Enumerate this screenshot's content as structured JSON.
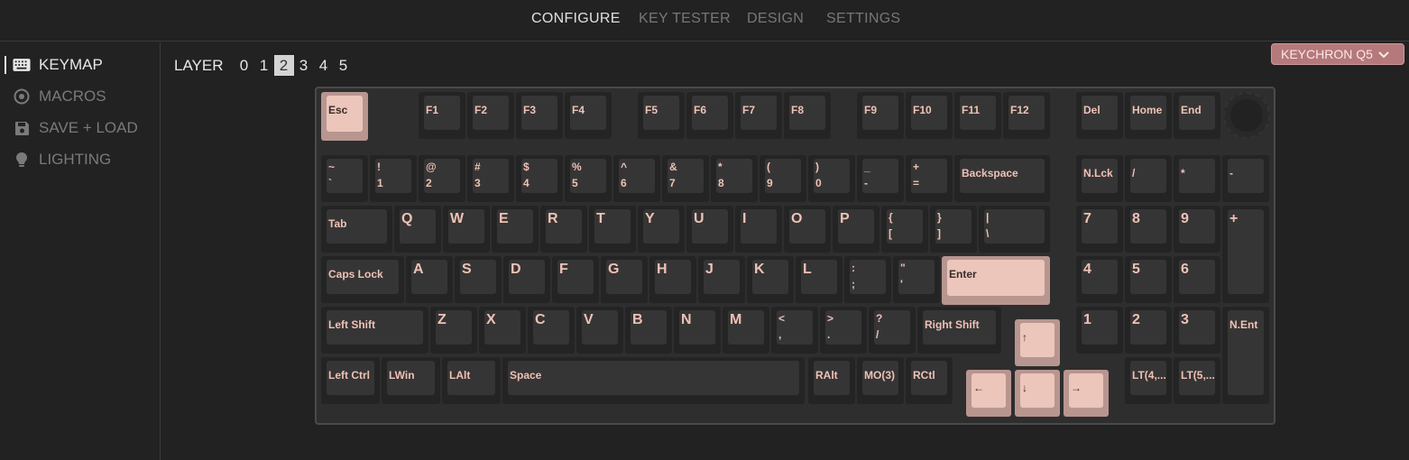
{
  "topnav": {
    "tabs": [
      {
        "label": "CONFIGURE"
      },
      {
        "label": "KEY TESTER"
      },
      {
        "label": "DESIGN"
      },
      {
        "label": "SETTINGS"
      }
    ]
  },
  "sidebar": {
    "items": [
      {
        "label": "KEYMAP",
        "icon": "keyboard-icon"
      },
      {
        "label": "MACROS",
        "icon": "macro-icon"
      },
      {
        "label": "SAVE + LOAD",
        "icon": "save-icon"
      },
      {
        "label": "LIGHTING",
        "icon": "lightbulb-icon"
      }
    ]
  },
  "layer": {
    "label": "LAYER",
    "options": [
      "0",
      "1",
      "2",
      "3",
      "4",
      "5"
    ],
    "selected": "2"
  },
  "keyboard_select": {
    "label": "KEYCHRON Q5",
    "chevron": "⌵"
  },
  "keys": {
    "esc": "Esc",
    "f1": "F1",
    "f2": "F2",
    "f3": "F3",
    "f4": "F4",
    "f5": "F5",
    "f6": "F6",
    "f7": "F7",
    "f8": "F8",
    "f9": "F9",
    "f10": "F10",
    "f11": "F11",
    "f12": "F12",
    "del": "Del",
    "home": "Home",
    "end": "End",
    "grave": [
      "~",
      "`"
    ],
    "n1": [
      "!",
      "1"
    ],
    "n2": [
      "@",
      "2"
    ],
    "n3": [
      "#",
      "3"
    ],
    "n4": [
      "$",
      "4"
    ],
    "n5": [
      "%",
      "5"
    ],
    "n6": [
      "^",
      "6"
    ],
    "n7": [
      "&",
      "7"
    ],
    "n8": [
      "*",
      "8"
    ],
    "n9": [
      "(",
      "9"
    ],
    "n0": [
      ")",
      "0"
    ],
    "minus": [
      "_",
      "-"
    ],
    "equal": [
      "+",
      "="
    ],
    "backspace": "Backspace",
    "nlck": "N.Lck",
    "kpslash": "/",
    "kpstar": "*",
    "kpminus": "-",
    "tab": "Tab",
    "q": "Q",
    "w": "W",
    "e": "E",
    "r": "R",
    "t": "T",
    "y": "Y",
    "u": "U",
    "i": "I",
    "o": "O",
    "p": "P",
    "lbracket": [
      "{",
      "["
    ],
    "rbracket": [
      "}",
      "]"
    ],
    "backslash": [
      "|",
      "\\"
    ],
    "kp7": "7",
    "kp8": "8",
    "kp9": "9",
    "kpplus": "+",
    "caps": "Caps Lock",
    "a": "A",
    "s": "S",
    "d": "D",
    "f": "F",
    "g": "G",
    "h": "H",
    "j": "J",
    "k": "K",
    "l": "L",
    "semicolon": [
      ":",
      ";"
    ],
    "quote": [
      "\"",
      "'"
    ],
    "enter": "Enter",
    "kp4": "4",
    "kp5": "5",
    "kp6": "6",
    "lshift": "Left Shift",
    "z": "Z",
    "x": "X",
    "c": "C",
    "v": "V",
    "b": "B",
    "n": "N",
    "m": "M",
    "comma": [
      "<",
      ","
    ],
    "period": [
      ">",
      "."
    ],
    "slash": [
      "?",
      "/"
    ],
    "rshift": "Right Shift",
    "up": "↑",
    "kp1": "1",
    "kp2": "2",
    "kp3": "3",
    "kpent": "N.Ent",
    "lctrl": "Left Ctrl",
    "lwin": "LWin",
    "lalt": "LAlt",
    "space": "Space",
    "ralt": "RAlt",
    "mo3": "MO(3)",
    "rctl": "RCtl",
    "left": "←",
    "down": "↓",
    "right": "→",
    "lt4": "LT(4,...",
    "lt5": "LT(5,..."
  }
}
